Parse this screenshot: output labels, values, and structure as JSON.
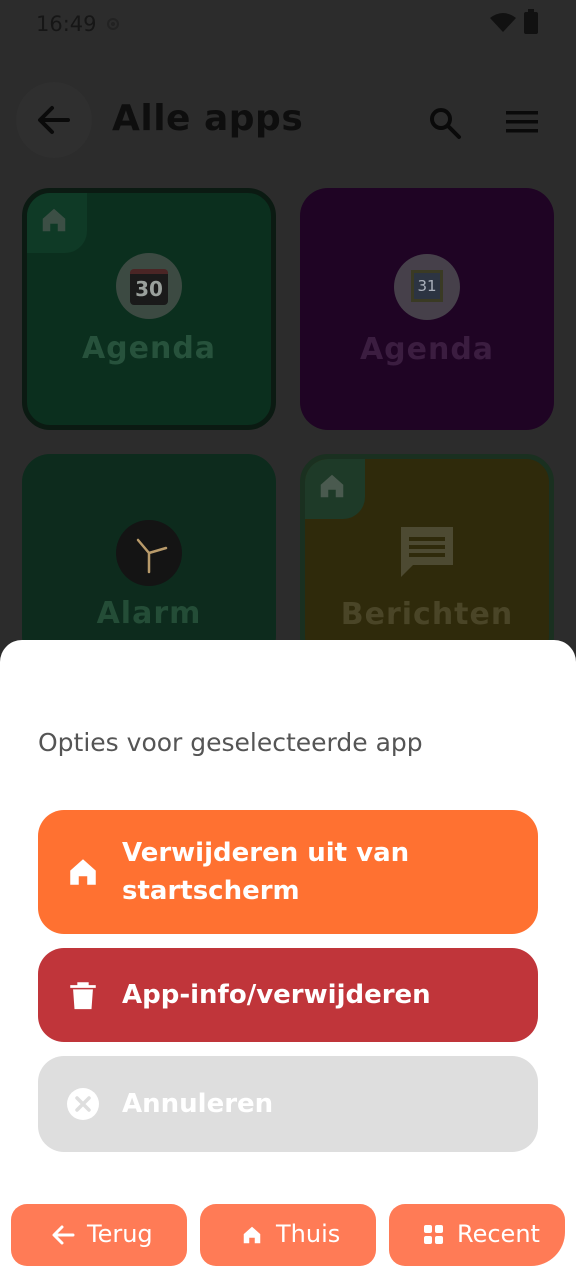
{
  "status": {
    "time": "16:49"
  },
  "header": {
    "title": "Alle apps"
  },
  "tiles": [
    {
      "label": "Agenda",
      "icon_text": "30",
      "pinned": true
    },
    {
      "label": "Agenda",
      "icon_text": "31",
      "pinned": false
    },
    {
      "label": "Alarm",
      "pinned": false
    },
    {
      "label": "Berichten",
      "pinned": true
    }
  ],
  "sheet": {
    "title": "Opties voor geselecteerde app",
    "options": [
      {
        "label_line1": "Verwijderen uit van",
        "label_line2": "startscherm",
        "icon": "home-icon",
        "color": "#ff7131"
      },
      {
        "label": "App-info/verwijderen",
        "icon": "trash-icon",
        "color": "#c0353a"
      },
      {
        "label": "Annuleren",
        "icon": "close-circle-icon",
        "color": "#dedede"
      }
    ]
  },
  "nav": {
    "back": "Terug",
    "home": "Thuis",
    "recent": "Recent"
  }
}
